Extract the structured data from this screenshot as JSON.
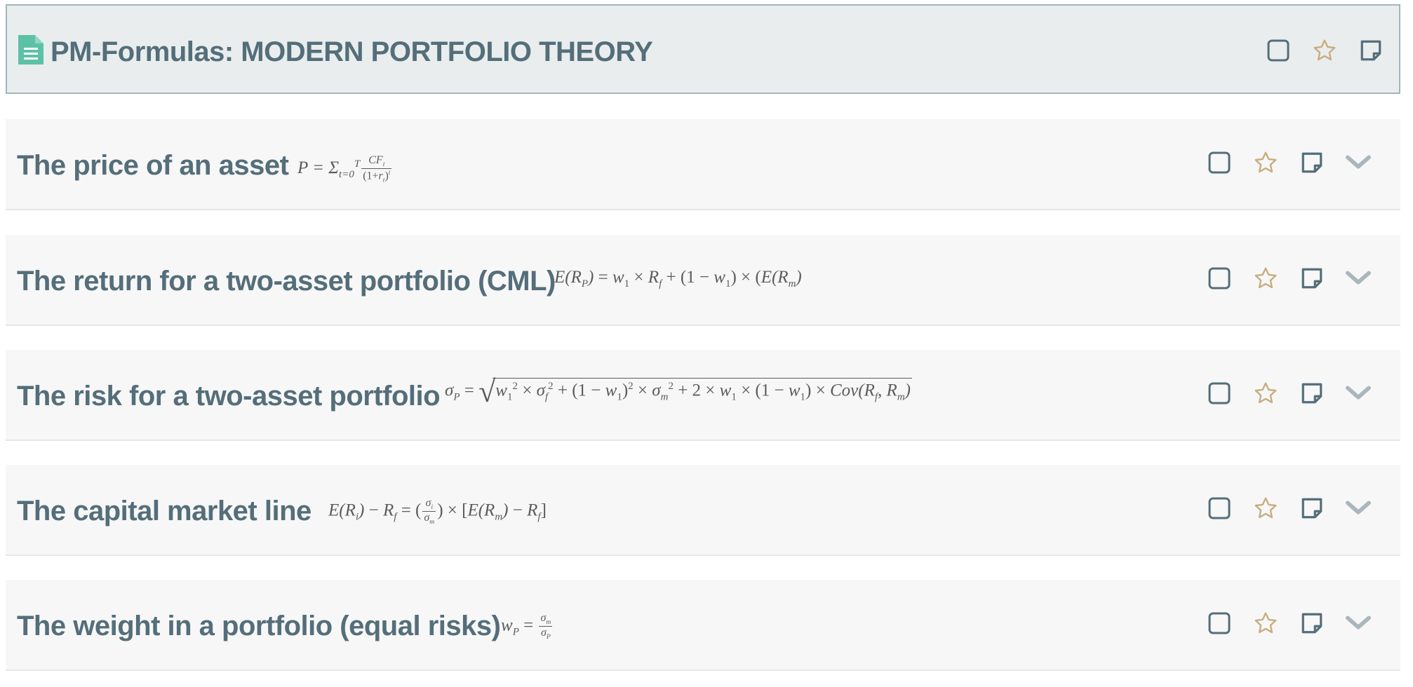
{
  "header": {
    "title": "PM-Formulas: MODERN PORTFOLIO THEORY",
    "icons": [
      "document-icon",
      "checkbox-icon",
      "star-icon",
      "note-icon"
    ]
  },
  "rows": [
    {
      "title": "The price of an asset",
      "formula": "P = Σ_{t=0}^{T} CF_t / (1+r_t)^t"
    },
    {
      "title": "The return for a two-asset portfolio (CML)",
      "formula": "E(R_P) = w_1 × R_f + (1 − w_1) × (E(R_m)"
    },
    {
      "title": "The risk for a two-asset portfolio",
      "formula": "σ_P = √(w_1^2 × σ_f^2 + (1 − w_1)^2 × σ_m^2 + 2 × w_1 × (1 − w_1) × Cov(R_f, R_m))"
    },
    {
      "title": "The capital market line",
      "formula": "E(R_i) − R_f = (σ_i / σ_m) × [E(R_m) − R_f]"
    },
    {
      "title": "The weight in a portfolio (equal risks)",
      "formula": "w_P = σ_m / σ_P"
    }
  ],
  "colors": {
    "text": "#546e7a",
    "header_bg": "#e9eded",
    "header_border": "#a4b5bc",
    "row_bg": "#f7f7f7",
    "doc_icon": "#5cc1a6",
    "star": "#c8ad7f",
    "chevron": "#a9b7bd"
  }
}
